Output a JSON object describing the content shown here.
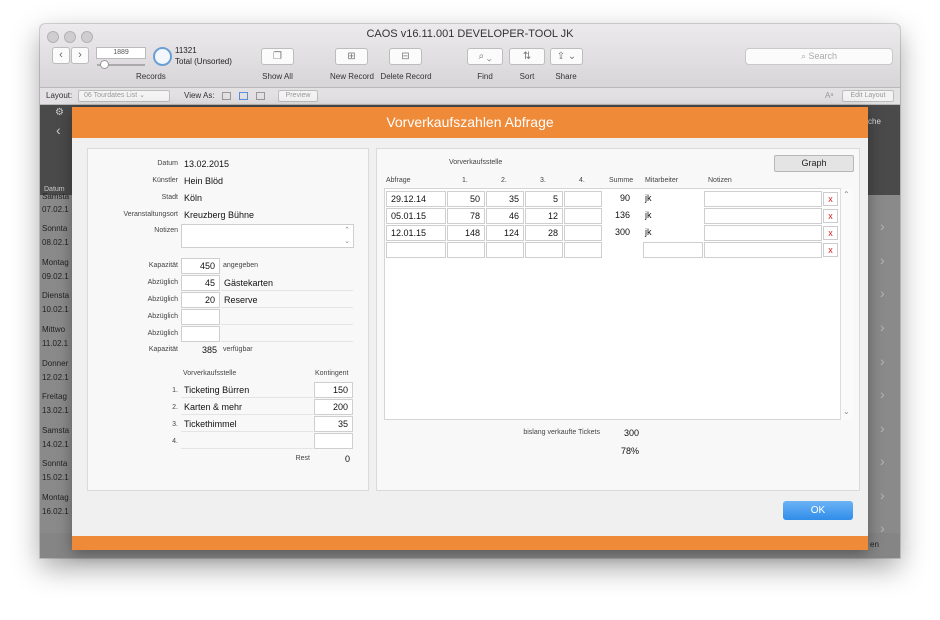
{
  "window": {
    "title": "CAOS v16.11.001  DEVELOPER-TOOL JK"
  },
  "toolbar": {
    "record_number": "1889",
    "records_label": "Records",
    "found_count": "11321",
    "found_status": "Total (Unsorted)",
    "show_all": "Show All",
    "new_record": "New Record",
    "delete_record": "Delete Record",
    "find": "Find",
    "sort": "Sort",
    "share": "Share",
    "search_placeholder": "Search"
  },
  "layoutbar": {
    "layout_label": "Layout:",
    "layout_value": "06 Tourdates List",
    "view_as_label": "View As:",
    "preview": "Preview",
    "edit_layout": "Edit Layout"
  },
  "background": {
    "col_datum": "Datum",
    "right_text": "che",
    "bottom_right": "en",
    "days": [
      {
        "day": "Samsta",
        "date": "07.02.1"
      },
      {
        "day": "Sonnta",
        "date": "08.02.1"
      },
      {
        "day": "Montag",
        "date": "09.02.1"
      },
      {
        "day": "Diensta",
        "date": "10.02.1"
      },
      {
        "day": "Mittwo",
        "date": "11.02.1"
      },
      {
        "day": "Donner",
        "date": "12.02.1"
      },
      {
        "day": "Freitag",
        "date": "13.02.1"
      },
      {
        "day": "Samsta",
        "date": "14.02.1"
      },
      {
        "day": "Sonnta",
        "date": "15.02.1"
      },
      {
        "day": "Montag",
        "date": "16.02.1"
      }
    ]
  },
  "dialog": {
    "title": "Vorverkaufszahlen Abfrage",
    "ok": "OK",
    "event": {
      "datum_label": "Datum",
      "datum": "13.02.2015",
      "kuenstler_label": "Künstler",
      "kuenstler": "Hein Blöd",
      "stadt_label": "Stadt",
      "stadt": "Köln",
      "ort_label": "Veranstaltungsort",
      "ort": "Kreuzberg Bühne",
      "notizen_label": "Notizen"
    },
    "capacity": {
      "kapazitaet_label": "Kapazität",
      "kapazitaet": "450",
      "angegeben": "angegeben",
      "abzueglich_label": "Abzüglich",
      "deductions": [
        {
          "value": "45",
          "text": "Gästekarten"
        },
        {
          "value": "20",
          "text": "Reserve"
        },
        {
          "value": "",
          "text": ""
        },
        {
          "value": "",
          "text": ""
        }
      ],
      "verfuegbar_value": "385",
      "verfuegbar": "verfügbar"
    },
    "vvk": {
      "header_stelle": "Vorverkaufsstelle",
      "header_kontingent": "Kontingent",
      "rows": [
        {
          "num": "1.",
          "name": "Ticketing Bürren",
          "kontingent": "150"
        },
        {
          "num": "2.",
          "name": "Karten & mehr",
          "kontingent": "200"
        },
        {
          "num": "3.",
          "name": "Tickethimmel",
          "kontingent": "35"
        },
        {
          "num": "4.",
          "name": "",
          "kontingent": ""
        }
      ],
      "rest_label": "Rest",
      "rest_value": "0"
    },
    "query": {
      "graph": "Graph",
      "header_group": "Vorverkaufsstelle",
      "col_abfrage": "Abfrage",
      "col_1": "1.",
      "col_2": "2.",
      "col_3": "3.",
      "col_4": "4.",
      "col_summe": "Summe",
      "col_mitarbeiter": "Mitarbeiter",
      "col_notizen": "Notizen",
      "delete_glyph": "x",
      "rows": [
        {
          "abfrage": "29.12.14",
          "v1": "50",
          "v2": "35",
          "v3": "5",
          "v4": "",
          "summe": "90",
          "mitarbeiter": "jk",
          "notizen": ""
        },
        {
          "abfrage": "05.01.15",
          "v1": "78",
          "v2": "46",
          "v3": "12",
          "v4": "",
          "summe": "136",
          "mitarbeiter": "jk",
          "notizen": ""
        },
        {
          "abfrage": "12.01.15",
          "v1": "148",
          "v2": "124",
          "v3": "28",
          "v4": "",
          "summe": "300",
          "mitarbeiter": "jk",
          "notizen": ""
        },
        {
          "abfrage": "",
          "v1": "",
          "v2": "",
          "v3": "",
          "v4": "",
          "summe": "",
          "mitarbeiter": "",
          "notizen": ""
        }
      ],
      "sold_label": "bislang verkaufte Tickets",
      "sold_value": "300",
      "sold_percent": "78%"
    }
  }
}
